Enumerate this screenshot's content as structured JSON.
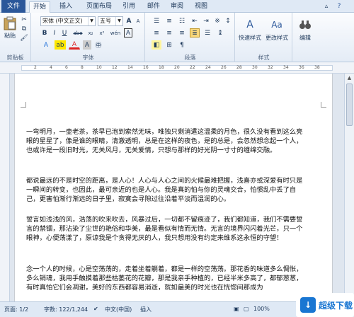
{
  "tabs": [
    "文件",
    "开始",
    "插入",
    "页面布局",
    "引用",
    "邮件",
    "审阅",
    "视图"
  ],
  "ribbon": {
    "paste_label": "粘贴",
    "clipboard_label": "剪贴板",
    "font_name": "宋体 (中文正文)",
    "font_size": "五号",
    "font_group_label": "字体",
    "paragraph_group_label": "段落",
    "quick_styles_label": "快速样式",
    "change_styles_label": "更改样式",
    "styles_group_label": "样式",
    "edit_label": "编辑",
    "bold": "B",
    "italic": "I",
    "underline": "U",
    "strike": "abe",
    "subscript": "x₂",
    "superscript": "x²",
    "grow": "A",
    "shrink": "A",
    "wen": "wén",
    "char_border": "A",
    "char_shade": "A",
    "font_color": "A"
  },
  "ruler_numbers": [
    "2",
    "4",
    "6",
    "8",
    "10",
    "12",
    "14",
    "16",
    "18",
    "20",
    "22",
    "24",
    "26",
    "28",
    "30",
    "32",
    "34",
    "36",
    "38"
  ],
  "document": {
    "paragraphs": [
      "一弯明月，一壶老茶，茶早已泡到索然无味，唯独只剩消遣这温柔的月色，很久没有看到这么亮眼的星星了，像是谁的眼睛，清澈透明，总是在这样的夜色，是的总是，会忽然想念起一个人，也或许是一段旧时光，无关风月，无关爱情，只想与那样的好光阴一寸寸的缠绵交融。",
      "都说最远的不是时空的距离，是人心！人心与人心之间的火候最难把握，浅喜亦或深爱有时只是一瞬间的转变，也因此，最可亲近的也是人心。我是真的怕与你的灵魂交合，怕惯乱中丢了自己，更害怕渐行渐远的日子里，寂寞会寻隙过往沿着平淡而温润的心。",
      "誓言如浅浅的风，浩荡的吹来吹去，风暴过后，一切都不留痕迹了，我们都知道，我们不需要誓言的禁锢，那沾染了尘世的艳俗和华美，最是看似有情而无情。无言的境界闪闪着光芒，只一个眼神，心便荡漾了，原谅我是个贪得无厌的人，我只想用没有约定来维系这永恒的守望！",
      "念一个人的时候，心是空荡荡的，走着坐着躺着，都是一样的空荡荡。那花香的味道多么惆怅，多么销魂，我用手触摸着那些枯萎花的花瓣，那是我亲手种植的，已经半米多高了，都郁葱葱，有时真怕它们会凋谢，美好的东西都容易消逝，就如最美的时光也在恍惚间那成为"
    ]
  },
  "status": {
    "page": "页面: 1/2",
    "words": "字数: 122/1,244",
    "lang": "中文(中国)",
    "mode": "插入",
    "zoom": "100%"
  },
  "watermark": {
    "logo": "↓",
    "text": "超级下载"
  }
}
